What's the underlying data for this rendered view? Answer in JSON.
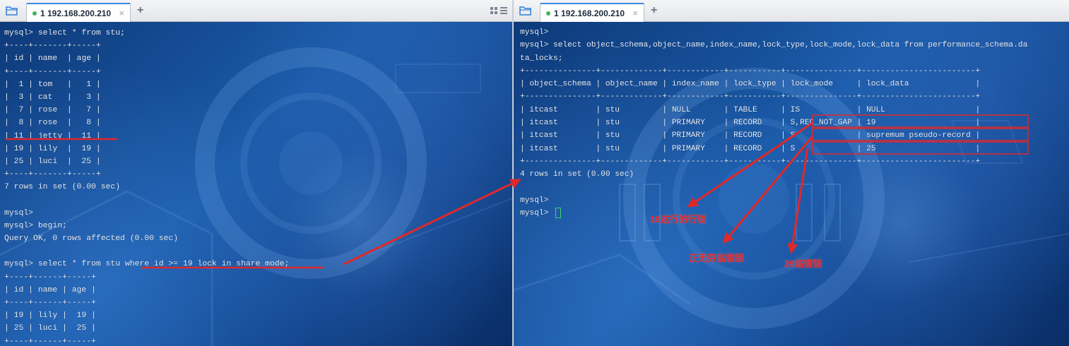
{
  "left_tab": {
    "label": "1 192.168.200.210",
    "close": "×",
    "plus": "+"
  },
  "right_tab": {
    "label": "1 192.168.200.210",
    "close": "×",
    "plus": "+"
  },
  "left_terminal": {
    "lines": [
      "mysql> select * from stu;",
      "+----+-------+-----+",
      "| id | name  | age |",
      "+----+-------+-----+",
      "|  1 | tom   |   1 |",
      "|  3 | cat   |   3 |",
      "|  7 | rose  |   7 |",
      "|  8 | rose  |   8 |",
      "| 11 | jetty |  11 |",
      "| 19 | lily  |  19 |",
      "| 25 | luci  |  25 |",
      "+----+-------+-----+",
      "7 rows in set (0.00 sec)",
      "",
      "mysql>",
      "mysql> begin;",
      "Query OK, 0 rows affected (0.00 sec)",
      "",
      "mysql> select * from stu where id >= 19 lock in share mode;",
      "+----+------+-----+",
      "| id | name | age |",
      "+----+------+-----+",
      "| 19 | lily |  19 |",
      "| 25 | luci |  25 |",
      "+----+------+-----+"
    ]
  },
  "right_terminal": {
    "lines": [
      "mysql>",
      "mysql> select object_schema,object_name,index_name,lock_type,lock_mode,lock_data from performance_schema.da",
      "ta_locks;",
      "+---------------+-------------+------------+-----------+---------------+------------------------+",
      "| object_schema | object_name | index_name | lock_type | lock_mode     | lock_data              |",
      "+---------------+-------------+------------+-----------+---------------+------------------------+",
      "| itcast        | stu         | NULL       | TABLE     | IS            | NULL                   |",
      "| itcast        | stu         | PRIMARY    | RECORD    | S,REC_NOT_GAP | 19                     |",
      "| itcast        | stu         | PRIMARY    | RECORD    | S             | supremum pseudo-record |",
      "| itcast        | stu         | PRIMARY    | RECORD    | S             | 25                     |",
      "+---------------+-------------+------------+-----------+---------------+------------------------+",
      "4 rows in set (0.00 sec)",
      "",
      "mysql>",
      "mysql> "
    ]
  },
  "annotations": {
    "label_row_lock": "19这行的行锁",
    "label_supremum": "正无穷临键锁",
    "label_next_key_25": "25临键锁"
  },
  "colors": {
    "annotation": "#e0282a",
    "cursor": "#3fd46b",
    "tab_accent": "#3b8be0"
  }
}
